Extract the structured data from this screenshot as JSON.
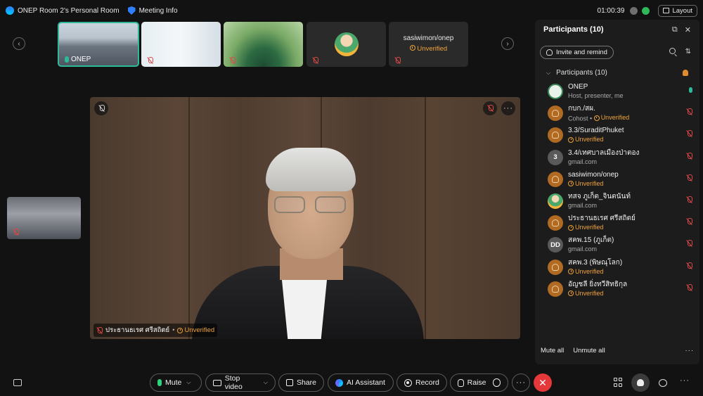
{
  "titlebar": {
    "room_title": "ONEP Room 2's Personal Room",
    "meeting_info": "Meeting Info",
    "timer": "01:00:39",
    "layout_label": "Layout"
  },
  "filmstrip": {
    "tiles": [
      {
        "name": "ONEP"
      },
      {
        "name": ""
      },
      {
        "name": ""
      },
      {
        "name": ""
      },
      {
        "name": "sasiwimon/onep",
        "status": "Unverified"
      }
    ]
  },
  "main_video": {
    "speaker_name": "ประธานธเรศ ศรีสถิตย์",
    "separator": "•",
    "status": "Unverified",
    "more": "···"
  },
  "participants_panel": {
    "title": "Participants (10)",
    "invite_label": "Invite and remind",
    "group_label": "Participants (10)",
    "items": [
      {
        "name": "ONEP",
        "sub": "Host, presenter, me"
      },
      {
        "name": "กบก./สผ.",
        "sub": "Cohost",
        "status": "Unverified"
      },
      {
        "name": "3.3/SuraditPhuket",
        "status": "Unverified"
      },
      {
        "name": "3.4/เทศบาลเมืองป่าตอง",
        "initials": "3",
        "sub": "gmail.com"
      },
      {
        "name": "sasiwimon/onep",
        "status": "Unverified"
      },
      {
        "name": "ทสจ ภูเก็ต_จินตนันท์",
        "sub": "gmail.com"
      },
      {
        "name": "ประธานธเรศ ศรีสถิตย์",
        "status": "Unverified"
      },
      {
        "name": "สคพ.15 (ภูเก็ต)",
        "initials": "DD",
        "sub": "gmail.com"
      },
      {
        "name": "สคพ.3 (พิษณุโลก)",
        "status": "Unverified"
      },
      {
        "name": "อัญชลี ยิ่งทวีสิทธิกุล",
        "status": "Unverified"
      }
    ],
    "mute_all": "Mute all",
    "unmute_all": "Unmute all",
    "more": "···"
  },
  "toolbar": {
    "mute_label": "Mute",
    "stop_video_label": "Stop video",
    "share_label": "Share",
    "ai_label": "AI Assistant",
    "record_label": "Record",
    "raise_label": "Raise",
    "more": "···",
    "leave": "✕",
    "side_more": "···"
  },
  "colors": {
    "background": "#121212",
    "panel": "#1c1c1c",
    "accent_green": "#2fb89a",
    "unverified_orange": "#f0a33b",
    "muted_red": "#e04848",
    "leave_red": "#e5383b"
  }
}
